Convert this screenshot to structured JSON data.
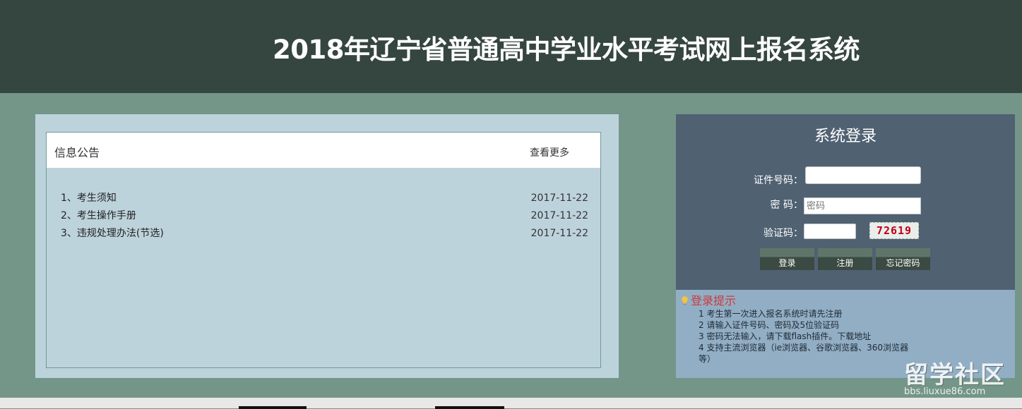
{
  "header": {
    "title": "2018年辽宁省普通高中学业水平考试网上报名系统"
  },
  "notice": {
    "title": "信息公告",
    "more_label": "查看更多",
    "items": [
      {
        "index": "1、",
        "text": "考生须知",
        "date": "2017-11-22"
      },
      {
        "index": "2、",
        "text": "考生操作手册",
        "date": "2017-11-22"
      },
      {
        "index": "3、",
        "text": "违规处理办法(节选)",
        "date": "2017-11-22"
      }
    ]
  },
  "login": {
    "title": "系统登录",
    "id_label": "证件号码：",
    "id_value": "",
    "password_label": "密 码：",
    "password_placeholder": "密码",
    "captcha_label": "验证码：",
    "captcha_value": "",
    "captcha_text": "72619",
    "login_button": "登录",
    "register_button": "注册",
    "forgot_button": "忘记密码"
  },
  "tips": {
    "title": "登录提示",
    "items": [
      "1 考生第一次进入报名系统时请先注册",
      "2 请输入证件号码、密码及5位验证码",
      "3 密码无法输入，请下载flash插件。下载地址",
      "4 支持主流浏览器（ie浏览器、谷歌浏览器、360浏览器等）"
    ]
  },
  "watermark": {
    "text": "留学社区",
    "url": "bbs.liuxue86.com"
  },
  "colors": {
    "header_bg": "#354540",
    "page_bg": "#749689",
    "login_bg": "#506172",
    "tips_bg": "#92aec4",
    "tips_title": "#cc3a3a",
    "captcha": "#c0001a"
  },
  "icons": {
    "tips_icon": "lightbulb-icon"
  }
}
